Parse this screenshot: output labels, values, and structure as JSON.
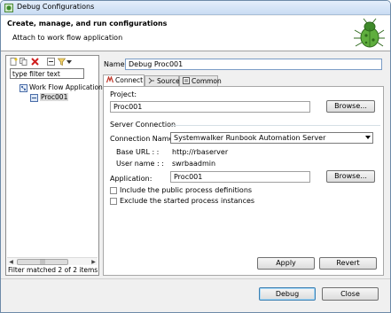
{
  "window": {
    "title": "Debug Configurations"
  },
  "header": {
    "title": "Create, manage, and run configurations",
    "subtitle": "Attach to work flow application",
    "icon": "bug-icon"
  },
  "left_panel": {
    "toolbar_icons": [
      "new-config-icon",
      "duplicate-icon",
      "delete-icon",
      "collapse-all-icon",
      "filter-icon",
      "dropdown-arrow-icon"
    ],
    "filter_text": "type filter text",
    "tree": [
      {
        "label": "Work Flow Application",
        "icon": "workflow-icon"
      },
      {
        "label": "Proc001",
        "icon": "process-icon",
        "selected": true
      }
    ],
    "status": "Filter matched 2 of 2 items"
  },
  "form": {
    "name_label": "Name:",
    "name_value": "Debug Proc001",
    "tabs": [
      {
        "label": "Connect",
        "icon": "connect-icon",
        "active": true
      },
      {
        "label": "Source",
        "icon": "source-icon",
        "active": false
      },
      {
        "label": "Common",
        "icon": "common-icon",
        "active": false
      }
    ],
    "project_label": "Project:",
    "project_value": "Proc001",
    "browse_label": "Browse...",
    "server_group_label": "Server Connection",
    "connection_name_label": "Connection Name ::",
    "connection_name_value": "Systemwalker Runbook Automation Server",
    "base_url_label": "Base URL : :",
    "base_url_value": "http://rbaserver",
    "username_label": "User name : :",
    "username_value": "swrbaadmin",
    "application_label": "Application:",
    "application_value": "Proc001",
    "include_public_label": "Include the public process definitions",
    "exclude_started_label": "Exclude the started process instances",
    "apply_label": "Apply",
    "revert_label": "Revert"
  },
  "footer": {
    "debug_label": "Debug",
    "close_label": "Close"
  }
}
